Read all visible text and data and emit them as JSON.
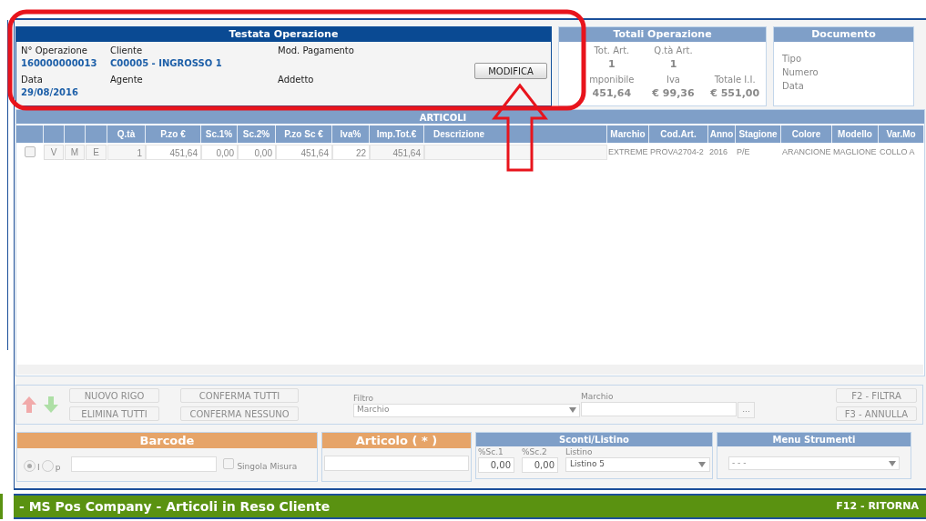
{
  "testata": {
    "title": "Testata Operazione",
    "fields": [
      {
        "label": "N° Operazione",
        "value": "160000000013"
      },
      {
        "label": "Cliente",
        "value": "C00005 - INGROSSO 1"
      },
      {
        "label": "Mod. Pagamento"
      },
      {
        "label": "Data",
        "value": "29/08/2016"
      },
      {
        "label": "Agente"
      },
      {
        "label": "Addetto"
      }
    ],
    "button": "MODIFICA"
  },
  "totali": {
    "title": "Totali Operazione",
    "items": [
      {
        "label": "Tot. Art.",
        "value": "1"
      },
      {
        "label": "Q.tà Art.",
        "value": "1"
      },
      {
        "label": "mponibile",
        "value": "451,64"
      },
      {
        "label": "Iva",
        "value": "€ 99,36"
      },
      {
        "label": "Totale I.I.",
        "value": "€ 551,00"
      }
    ]
  },
  "documento": {
    "title": "Documento",
    "labels": [
      "Tipo",
      "Numero",
      "Data"
    ]
  },
  "articoli": {
    "title": "ARTICOLI",
    "columns": [
      "",
      "",
      "",
      "",
      "Q.tà",
      "P.zo €",
      "Sc.1%",
      "Sc.2%",
      "P.zo Sc €",
      "Iva%",
      "Imp.Tot.€",
      "Descrizione",
      "Marchio",
      "Cod.Art.",
      "Anno",
      "Stagione",
      "Colore",
      "Modello",
      "Var.Mo"
    ],
    "rows": [
      {
        "checked": false,
        "cells": [
          "",
          "V",
          "M",
          "E",
          "1",
          "451,64",
          "0,00",
          "0,00",
          "451,64",
          "22",
          "451,64",
          "",
          "EXTREME",
          "PROVA2704-2",
          "2016",
          "P/E",
          "ARANCIONE",
          "MAGLIONE",
          "COLLO A"
        ]
      }
    ]
  },
  "toolbar": {
    "buttons": [
      {
        "label": "NUOVO RIGO",
        "disabled": true
      },
      {
        "label": "CONFERMA TUTTI",
        "disabled": true
      },
      {
        "label": "ELIMINA TUTTI",
        "disabled": true
      },
      {
        "label": "CONFERMA NESSUNO",
        "disabled": true
      }
    ],
    "filtro": {
      "label": "Filtro",
      "value": "Marchio"
    },
    "marchio": {
      "label": "Marchio",
      "button": "..."
    },
    "actions": [
      {
        "label": "F2 - FILTRA",
        "disabled": true
      },
      {
        "label": "F3 - ANNULLA",
        "disabled": true
      }
    ]
  },
  "barcode": {
    "title": "Barcode",
    "radios": [
      {
        "label": "I",
        "selected": true
      },
      {
        "label": "p",
        "selected": false
      }
    ],
    "checkbox": {
      "label": "Singola Misura",
      "checked": false
    }
  },
  "articolo": {
    "title": "Articolo ( * )"
  },
  "sconti": {
    "title": "Sconti/Listino",
    "fields": [
      {
        "label": "%Sc.1",
        "value": "0,00"
      },
      {
        "label": "%Sc.2",
        "value": "0,00"
      }
    ],
    "listino": {
      "label": "Listino",
      "value": "Listino 5"
    }
  },
  "menu": {
    "title": "Menu Strumenti",
    "value": "- - -"
  },
  "status_bar": {
    "title": "- MS Pos Company - Articoli in Reso Cliente",
    "action": "F12 - RITORNA"
  }
}
